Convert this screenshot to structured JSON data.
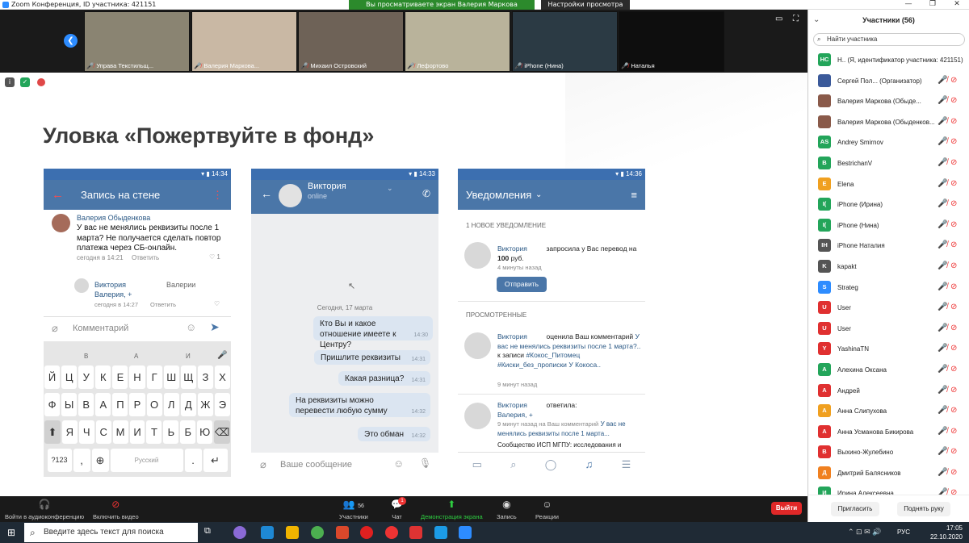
{
  "window": {
    "title": "Zoom Конференция, ID участника: 421151",
    "min": "—",
    "max": "❐",
    "close": "✕"
  },
  "banner": {
    "viewing": "Вы просматриваете экран Валерия Маркова (Обыденкова)",
    "view_settings": "Настройки просмотра ⌄"
  },
  "thumbnails": [
    {
      "name": "Управа Текстильщ...",
      "bg": "#8a8472"
    },
    {
      "name": "Валерия Маркова...",
      "bg": "#c9b8a4"
    },
    {
      "name": "Михаил Островский",
      "bg": "#6e6257"
    },
    {
      "name": "Лефортово",
      "bg": "#b9b39b"
    },
    {
      "name": "iPhone (Нина)",
      "bg": "#2b3a44"
    },
    {
      "name": "Наталья",
      "bg": "#0e0e0e"
    }
  ],
  "slide": {
    "title": "Уловка «Пожертвуйте в фонд»",
    "phone1": {
      "time": "14:34",
      "header": "Запись на стене",
      "author": "Валерия Обыденкова",
      "post": "У вас не менялись реквизиты после 1 марта? Не получается сделать повтор платежа через СБ-онлайн.",
      "post_meta": "сегодня в 14:21",
      "reply_label": "Ответить",
      "likes": "1",
      "reply_author": "Виктория",
      "reply_to": "Валерии",
      "reply_text": "Валерия, +",
      "reply_meta": "сегодня в 14:27",
      "comment_placeholder": "Комментарий",
      "kb_top": [
        "В",
        "А",
        "И"
      ],
      "kb_row1": [
        "Й",
        "Ц",
        "У",
        "К",
        "Е",
        "Н",
        "Г",
        "Ш",
        "Щ",
        "З",
        "Х"
      ],
      "kb_row2": [
        "Ф",
        "Ы",
        "В",
        "А",
        "П",
        "Р",
        "О",
        "Л",
        "Д",
        "Ж",
        "Э"
      ],
      "kb_row3": [
        "Я",
        "Ч",
        "С",
        "М",
        "И",
        "Т",
        "Ь",
        "Б",
        "Ю"
      ],
      "kb_num": "?123",
      "kb_comma": ",",
      "kb_space": "Русский",
      "kb_dot": "."
    },
    "phone2": {
      "time": "14:33",
      "contact": "Виктория",
      "status": "online",
      "date": "Сегодня, 17 марта",
      "messages": [
        {
          "text": "Кто Вы и какое отношение имеете к Центру?",
          "time": "14:30"
        },
        {
          "text": "Пришлите реквизиты",
          "time": "14:31"
        },
        {
          "text": "Какая разница?",
          "time": "14:31"
        },
        {
          "text": "На реквизиты можно перевести любую сумму",
          "time": "14:32"
        },
        {
          "text": "Это обман",
          "time": "14:32"
        }
      ],
      "input_placeholder": "Ваше сообщение"
    },
    "phone3": {
      "time": "14:36",
      "header": "Уведомления",
      "new_label": "1 НОВОЕ УВЕДОМЛЕНИЕ",
      "n1_name": "Виктория",
      "n1_text": "запросила у Вас перевод на",
      "n1_amount": "100",
      "n1_currency": "руб.",
      "n1_time": "4 минуты назад",
      "send_button": "Отправить",
      "seen_label": "ПРОСМОТРЕННЫЕ",
      "n2_name": "Виктория",
      "n2_action": "оценила Ваш комментарий",
      "n2_link": "У вас не менялись реквизиты после 1 марта?..",
      "n2_mid": "к записи",
      "n2_tags": "#Кокос_Питомец #Киски_без_прописки",
      "n2_tail": "У Кокоса..",
      "n2_time": "9 минут назад",
      "n3_name": "Виктория",
      "n3_action": "ответила:",
      "n3_text": "Валерия, +",
      "n3_meta": "9 минут назад на Ваш комментарий",
      "n3_link": "У вас не менялись реквизиты после 1 марта...",
      "n4_text": "Сообщество ИСП МГПУ: исследования и"
    }
  },
  "participants": {
    "header": "Участники (56)",
    "search_placeholder": "Найти участника",
    "list": [
      {
        "initials": "НС",
        "name": "Н.. (Я, идентификатор участника: 421151)",
        "color": "#23a55a"
      },
      {
        "initials": "",
        "name": "Сергей Пол... (Организатор)",
        "color": "#3b5a9a"
      },
      {
        "initials": "",
        "name": "Валерия Маркова (Обыде...",
        "color": "#8a5a4a"
      },
      {
        "initials": "",
        "name": "Валерия Маркова (Обыденков...",
        "color": "#8a5a4a"
      },
      {
        "initials": "AS",
        "name": "Andrey Smirnov",
        "color": "#23a55a"
      },
      {
        "initials": "B",
        "name": "BestrichanV",
        "color": "#23a55a"
      },
      {
        "initials": "E",
        "name": "Elena",
        "color": "#f0a020"
      },
      {
        "initials": "I(",
        "name": "iPhone (Ирина)",
        "color": "#23a55a"
      },
      {
        "initials": "I(",
        "name": "iPhone (Нина)",
        "color": "#23a55a"
      },
      {
        "initials": "IH",
        "name": "iPhone Наталия",
        "color": "#555555"
      },
      {
        "initials": "K",
        "name": "kapakt",
        "color": "#555555"
      },
      {
        "initials": "S",
        "name": "Strateg",
        "color": "#2d8cff"
      },
      {
        "initials": "U",
        "name": "User",
        "color": "#e03030"
      },
      {
        "initials": "U",
        "name": "User",
        "color": "#e03030"
      },
      {
        "initials": "Y",
        "name": "YashinaTN",
        "color": "#e03030"
      },
      {
        "initials": "А",
        "name": "Алехина Оксана",
        "color": "#23a55a"
      },
      {
        "initials": "А",
        "name": "Андрей",
        "color": "#e03030"
      },
      {
        "initials": "А",
        "name": "Анна Слипухова",
        "color": "#f0a020"
      },
      {
        "initials": "А",
        "name": "Анна Усманова Бикирова",
        "color": "#e03030"
      },
      {
        "initials": "В",
        "name": "Выхино-Жулебино",
        "color": "#e03030"
      },
      {
        "initials": "Д",
        "name": "Дмитрий Балясников",
        "color": "#f08020"
      },
      {
        "initials": "И",
        "name": "Ирина Алексеевна",
        "color": "#23a55a"
      }
    ],
    "invite": "Пригласить",
    "raise_hand": "Поднять руку"
  },
  "toolbar": {
    "audio": "Войти в аудиоконференцию",
    "video": "Включить видео",
    "participants": "Участники",
    "participants_count": "56",
    "chat": "Чат",
    "chat_badge": "1",
    "screen_share": "Демонстрация экрана",
    "record": "Запись",
    "reactions": "Реакции",
    "leave": "Выйти"
  },
  "taskbar": {
    "search_placeholder": "Введите здесь текст для поиска",
    "lang": "РУС",
    "time": "17:05",
    "date": "22.10.2020"
  }
}
